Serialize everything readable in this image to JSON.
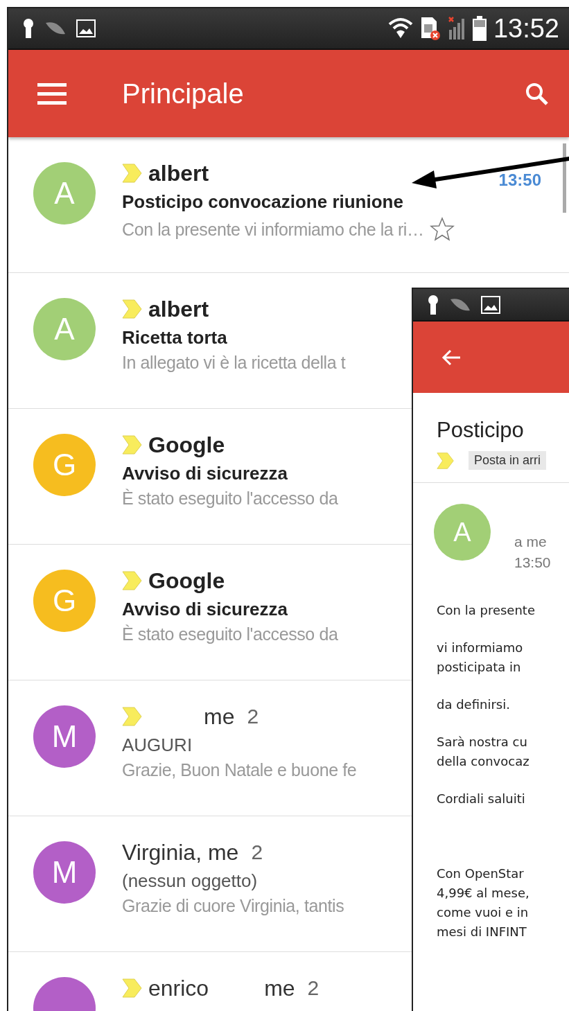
{
  "status_bar": {
    "time": "13:52"
  },
  "toolbar": {
    "title": "Principale"
  },
  "messages": [
    {
      "avatar": "A",
      "color": "#a2cf76",
      "important": true,
      "senders": [
        "albert"
      ],
      "unread": true,
      "subject": "Posticipo convocazione riunione",
      "snippet": "Con la presente vi informiamo che la ri…",
      "time": "13:50",
      "starred": false
    },
    {
      "avatar": "A",
      "color": "#a2cf76",
      "important": true,
      "senders": [
        "albert"
      ],
      "unread": true,
      "subject": "Ricetta torta",
      "snippet": "In allegato vi è la ricetta della t"
    },
    {
      "avatar": "G",
      "color": "#f6bd1f",
      "important": true,
      "senders": [
        "Google"
      ],
      "unread": true,
      "subject": "Avviso di sicurezza",
      "snippet": "È stato eseguito l'accesso da"
    },
    {
      "avatar": "G",
      "color": "#f6bd1f",
      "important": true,
      "senders": [
        "Google"
      ],
      "unread": true,
      "subject": "Avviso di sicurezza",
      "snippet": "È stato eseguito l'accesso da"
    },
    {
      "avatar": "M",
      "color": "#b35fc7",
      "important": true,
      "senders": [
        "me"
      ],
      "count": "2",
      "unread": false,
      "subject": "AUGURI",
      "snippet": "Grazie, Buon Natale e buone fe"
    },
    {
      "avatar": "M",
      "color": "#b35fc7",
      "important": false,
      "senders": [
        "Virginia, me"
      ],
      "count": "2",
      "unread": false,
      "subject": "(nessun oggetto)",
      "snippet": "Grazie di cuore Virginia, tantis"
    },
    {
      "color": "#b35fc7",
      "important": true,
      "senders": [
        "enrico",
        "me"
      ],
      "count": "2",
      "unread": false
    }
  ],
  "detail": {
    "subject": "Posticipo",
    "label": "Posta in arri",
    "avatar": "A",
    "color": "#a2cf76",
    "recipient": "a me",
    "time": "13:50",
    "paragraphs": [
      [
        "Con la presente"
      ],
      [
        "vi informiamo",
        "posticipata in"
      ],
      [
        "da definirsi."
      ],
      [
        "Sarà nostra cu",
        "della convocaz"
      ],
      [
        "Cordiali saluiti"
      ],
      [
        "Con OpenStar",
        "4,99€ al mese,",
        "come vuoi e in",
        "mesi di INFINT"
      ]
    ]
  }
}
